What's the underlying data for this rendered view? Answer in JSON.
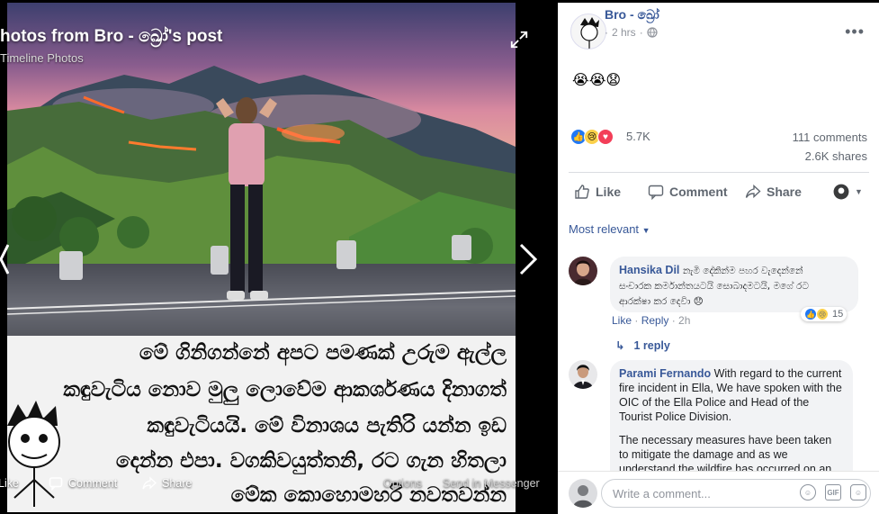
{
  "viewer": {
    "title": "hotos from Bro - ඛ්‍රෝ's post",
    "subtitle": "Timeline Photos",
    "caption_lines": [
      "මේ ගිනිගන්නේ අපට පමණක් උරුම ඇල්ල",
      "කඳුවැටිය නොව මුලු ලොවේම ආකර්ශණය දිනාගත්",
      "කඳුවැටියයි. මේ විනාශය පැතිරි යන්න ඉඩ",
      "දෙන්න එපා. වගකිවයුත්තනි, රට ගැන හිතලා",
      "මේක කොහොමහරි නවතවන්න"
    ],
    "actions": {
      "like": "Like",
      "comment": "Comment",
      "share": "Share",
      "options": "Options",
      "send": "Send in Messenger"
    }
  },
  "post": {
    "author": "Bro - ඛ්‍රෝ",
    "time": "2 hrs",
    "body": "😭😭😧",
    "reactions_count": "5.7K",
    "comments_count": "111 comments",
    "shares_count": "2.6K shares",
    "actions": {
      "like": "Like",
      "comment": "Comment",
      "share": "Share"
    },
    "sort_label": "Most relevant"
  },
  "comments": [
    {
      "name": "Hansika Dil",
      "text_lines": [
        "නැමි දේකින්ම පහර වැදෙන්නේ",
        "සංචාරක කර්මාන්තයටයි සොබාදමටයි, මගේ රට",
        "ආරක්ෂා කර දෙවිා 😞"
      ],
      "meta_like": "Like",
      "meta_reply": "Reply",
      "meta_time": "2h",
      "reaction_count": "15",
      "replies_label": "1 reply"
    },
    {
      "name": "Parami Fernando",
      "text_first": "With regard to the current fire incident in Ella, We have spoken with the OIC of the Ella Police and Head of the Tourist Police Division.",
      "text_second": "The necessary measures have been taken to mitigate the damage and as we understand the wildfire has occurred on an"
    }
  ],
  "composer": {
    "placeholder": "Write a comment..."
  },
  "icons": {
    "expand": "expand-icon",
    "next": "chevron-right-icon",
    "globe": "globe-icon",
    "like": "thumbs-up-icon",
    "comment": "speech-bubble-icon",
    "share": "share-arrow-icon",
    "emoji": "smiley-icon",
    "gif": "gif-icon",
    "sticker": "sticker-icon"
  },
  "colors": {
    "link": "#385898",
    "muted": "#90949c",
    "like_blue": "#2078f4",
    "love_red": "#f33e58"
  }
}
